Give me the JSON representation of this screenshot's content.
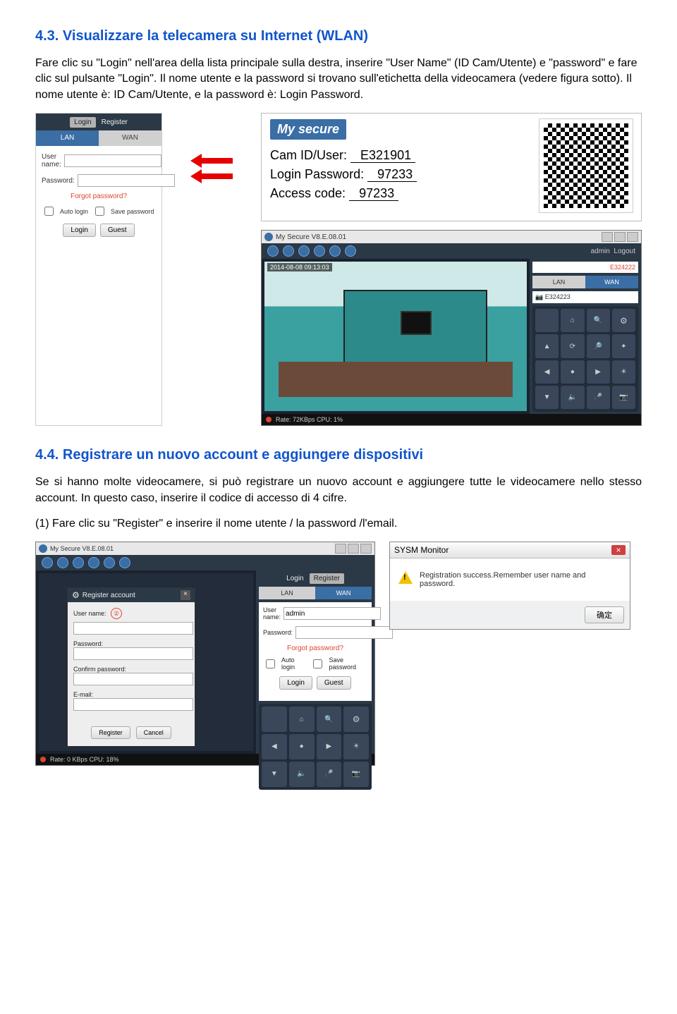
{
  "section43": {
    "heading": "4.3. Visualizzare la telecamera su Internet (WLAN)",
    "para": "Fare clic su \"Login\" nell'area della lista principale sulla destra, inserire \"User Name\" (ID Cam/Utente) e \"password\" e fare clic sul pulsante \"Login\". Il nome utente e la password si trovano sull'etichetta della videocamera (vedere figura sotto). Il nome utente è: ID Cam/Utente, e la password è: Login Password."
  },
  "login_panel": {
    "login_tab": "Login",
    "register_tab": "Register",
    "lan": "LAN",
    "wan": "WAN",
    "user_label": "User name:",
    "pass_label": "Password:",
    "forgot": "Forgot password?",
    "auto_login": "Auto login",
    "save_password": "Save password",
    "login_btn": "Login",
    "guest_btn": "Guest"
  },
  "sticker": {
    "brand": "My secure",
    "cam_label": "Cam ID/User:",
    "cam_val": "E321901",
    "login_label": "Login Password:",
    "login_val": "97233",
    "access_label": "Access code:",
    "access_val": "97233"
  },
  "appwin": {
    "title": "My Secure  V8.E.08.01",
    "admin": "admin",
    "logout": "Logout",
    "lan": "LAN",
    "wan": "WAN",
    "cam_id_red": "E324222",
    "cam_list": "E324223",
    "timestamp": "2014-08-08 09:13:03",
    "rate": "Rate: 72KBps CPU:  1%"
  },
  "section44": {
    "heading": "4.4. Registrare un nuovo account e aggiungere dispositivi",
    "para": "Se si hanno molte videocamere, si può registrare un nuovo account e aggiungere tutte le videocamere nello stesso account. In questo caso, inserire il codice di accesso di 4 cifre.",
    "line2": "(1) Fare clic su \"Register\" e inserire il nome utente / la password /l'email."
  },
  "appwin2": {
    "title": "My Secure  V8.E.08.01",
    "rate": "Rate: 0 KBps CPU:  18%",
    "login_tab": "Login",
    "register_tab": "Register",
    "lan": "LAN",
    "wan": "WAN",
    "user_label": "User name:",
    "user_val": "admin",
    "pass_label": "Password:",
    "forgot": "Forgot password?",
    "auto_login": "Auto login",
    "save_password": "Save password",
    "login_btn": "Login",
    "guest_btn": "Guest"
  },
  "register_dialog": {
    "title": "Register account",
    "num": "②",
    "user_label": "User name:",
    "pass_label": "Password:",
    "confirm_label": "Confirm password:",
    "email_label": "E-mail:",
    "register_btn": "Register",
    "cancel_btn": "Cancel"
  },
  "sysm": {
    "title": "SYSM Monitor",
    "msg": "Registration success.Remember user name and password.",
    "ok": "确定"
  }
}
